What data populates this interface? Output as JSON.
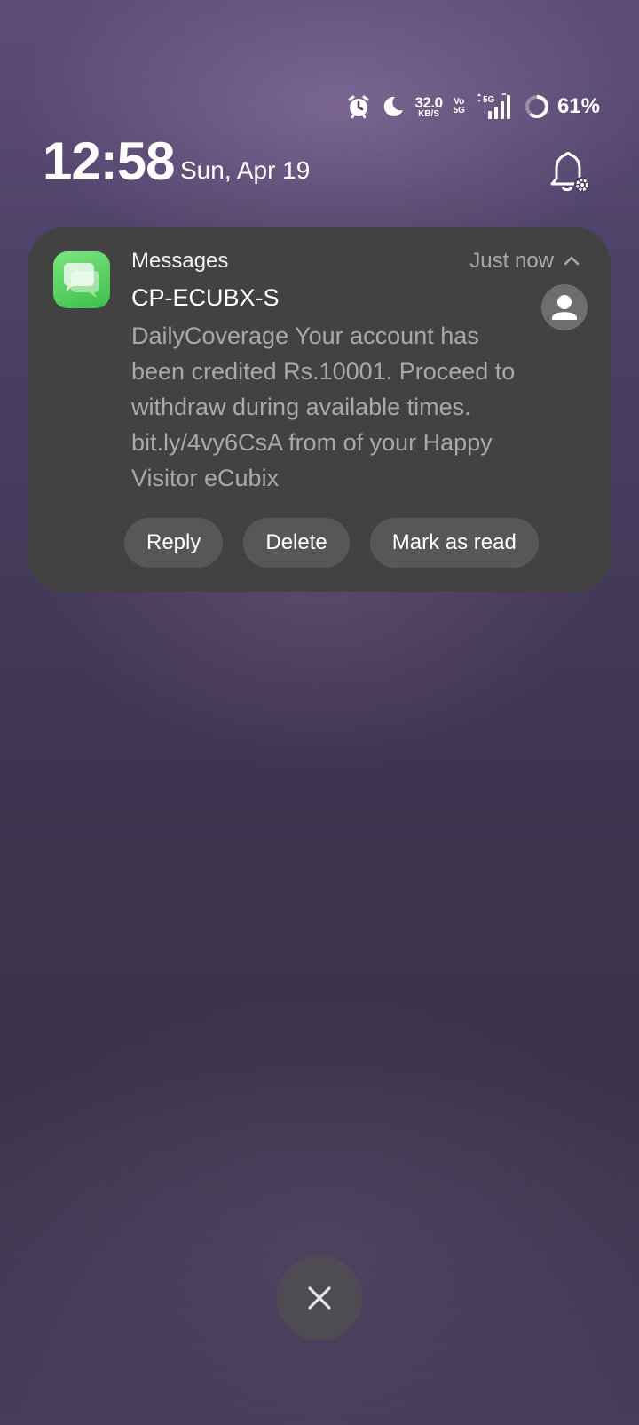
{
  "status_bar": {
    "icons": [
      "alarm-icon",
      "moon-icon",
      "network-speed-icon",
      "volte-icon",
      "signal-icon",
      "battery-icon"
    ],
    "net_speed_value": "32.0",
    "net_speed_unit": "KB/S",
    "volte_top": "Vo",
    "volte_bottom": "5G",
    "network_type": "5G",
    "battery_percent": "61%",
    "battery_level": 0.61
  },
  "lockscreen": {
    "time": "12:58",
    "date": "Sun, Apr 19"
  },
  "notification": {
    "app_name": "Messages",
    "timestamp": "Just now",
    "sender": "CP-ECUBX-S",
    "body": "DailyCoverage Your account has been credited Rs.10001. Proceed to withdraw during available times. bit.ly/4vy6CsA from of your Happy Visitor eCubix",
    "actions": [
      "Reply",
      "Delete",
      "Mark as read"
    ]
  },
  "colors": {
    "card_bg": "#424242",
    "action_bg": "#575757",
    "app_icon_green": "#4cd35a",
    "secondary_text": "#a9a9a9"
  }
}
